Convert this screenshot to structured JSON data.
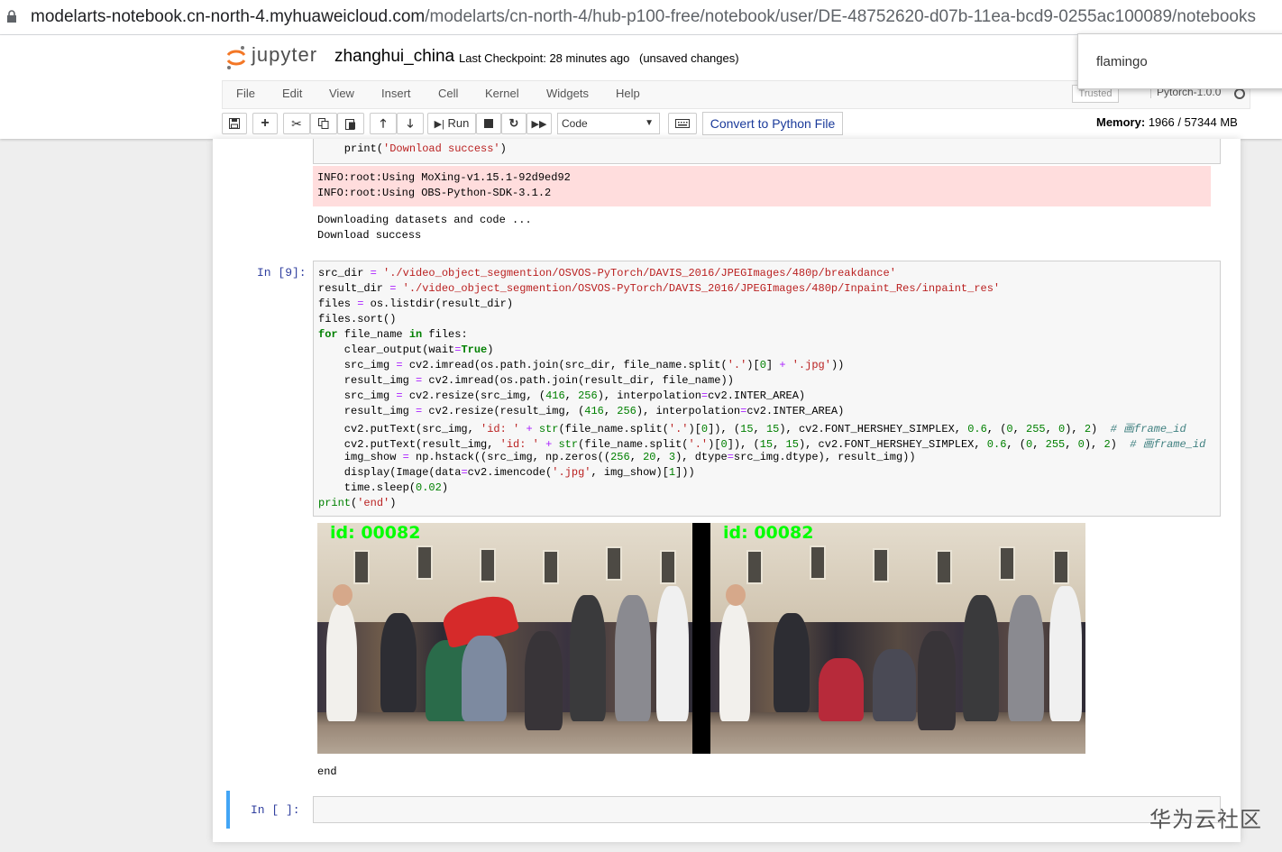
{
  "browser": {
    "url_domain": "modelarts-notebook.cn-north-4.myhuaweicloud.com",
    "url_path": "/modelarts/cn-north-4/hub-p100-free/notebook/user/DE-48752620-d07b-11ea-bcd9-0255ac100089/notebooks"
  },
  "header": {
    "logo_text": "jupyter",
    "notebook_name": "zhanghui_china",
    "checkpoint": "Last Checkpoint: 28 minutes ago",
    "unsaved": "(unsaved changes)",
    "user_popup": "flamingo"
  },
  "menu": [
    "File",
    "Edit",
    "View",
    "Insert",
    "Cell",
    "Kernel",
    "Widgets",
    "Help"
  ],
  "status": {
    "trusted": "Trusted",
    "kernel": "Pytorch-1.0.0"
  },
  "toolbar": {
    "run_label": "Run",
    "cell_type": "Code",
    "convert_label": "Convert to Python File",
    "memory_label": "Memory:",
    "memory_value": "1966 / 57344 MB"
  },
  "cells": {
    "cell1_tail": "    print('Download success')",
    "stderr": [
      "INFO:root:Using MoXing-v1.15.1-92d9ed92",
      "INFO:root:Using OBS-Python-SDK-3.1.2"
    ],
    "stdout": [
      "Downloading datasets and code ...",
      "Download success"
    ],
    "cell2_prompt": "In  [9]:",
    "cell2_output_text": "end",
    "image_labels": [
      "id: 00082",
      "id: 00082"
    ],
    "cell3_prompt": "In  [ ]:"
  },
  "colors": {
    "prompt_blue": "#303f9f",
    "stderr_bg": "#ffdddd",
    "active_cell_border": "#42a5f5",
    "convert_text": "#1a3a9a"
  },
  "icons": [
    "save-icon",
    "plus-icon",
    "cut-icon",
    "copy-icon",
    "paste-icon",
    "arrow-up-icon",
    "arrow-down-icon",
    "run-icon",
    "stop-icon",
    "restart-icon",
    "fast-forward-icon",
    "keyboard-icon",
    "lock-icon"
  ],
  "watermark": "华为云社区"
}
